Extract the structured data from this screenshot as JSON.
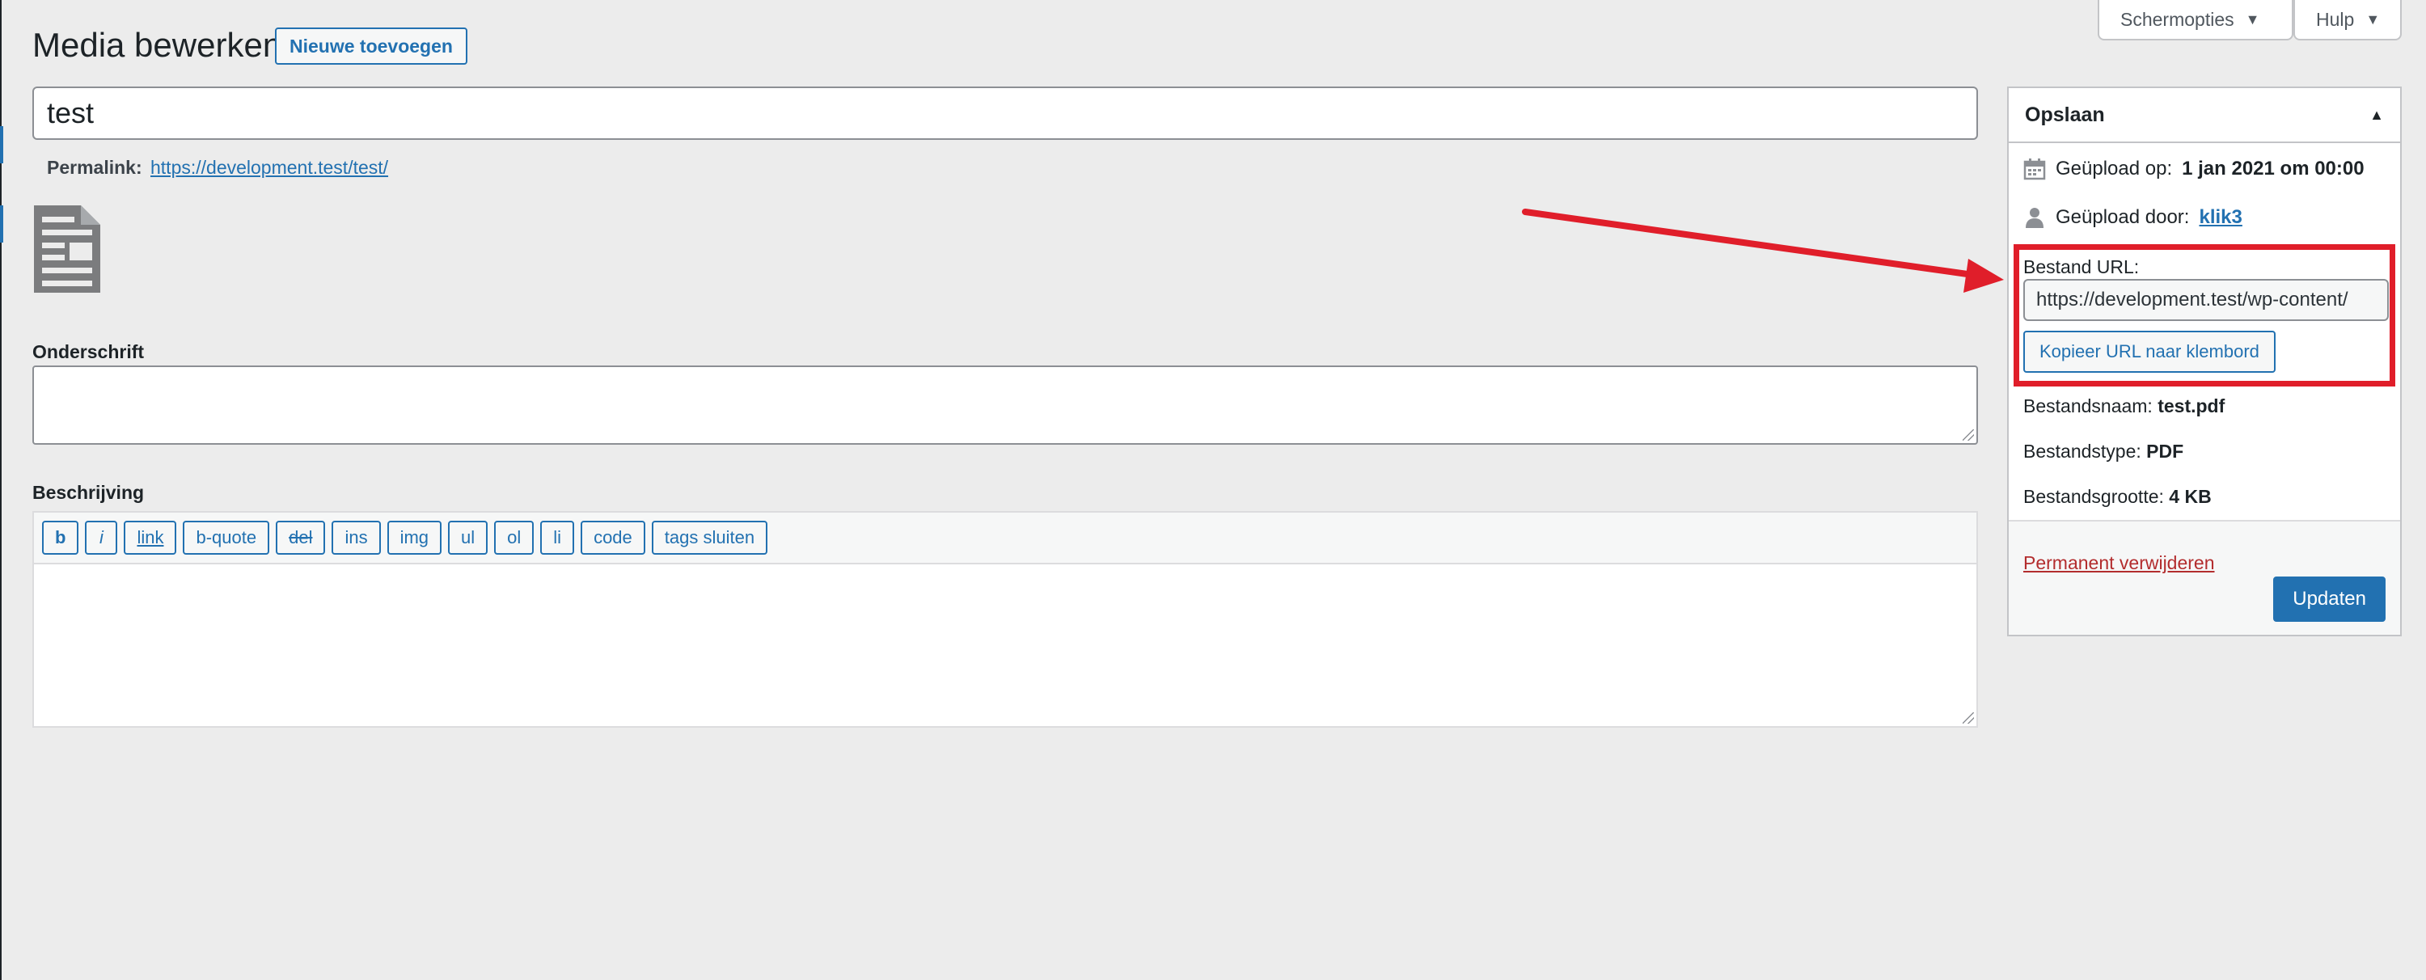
{
  "screen_tabs": {
    "screen_options": "Schermopties",
    "help": "Hulp"
  },
  "page": {
    "title": "Media bewerken",
    "add_new": "Nieuwe toevoegen"
  },
  "title_field": {
    "value": "test"
  },
  "permalink": {
    "label": "Permalink:",
    "url": "https://development.test/test/"
  },
  "caption": {
    "label": "Onderschrift",
    "value": ""
  },
  "description": {
    "label": "Beschrijving",
    "toolbar": [
      "b",
      "i",
      "link",
      "b-quote",
      "del",
      "ins",
      "img",
      "ul",
      "ol",
      "li",
      "code",
      "tags sluiten"
    ],
    "value": ""
  },
  "save_box": {
    "title": "Opslaan",
    "uploaded_on_label": "Geüpload op:",
    "uploaded_on_value": "1 jan 2021 om 00:00",
    "uploaded_by_label": "Geüpload door:",
    "uploaded_by_value": "klik3",
    "file_url_label": "Bestand URL:",
    "file_url_value": "https://development.test/wp-content/",
    "copy_button": "Kopieer URL naar klembord",
    "filename_label": "Bestandsnaam:",
    "filename_value": "test.pdf",
    "filetype_label": "Bestandstype:",
    "filetype_value": "PDF",
    "filesize_label": "Bestandsgrootte:",
    "filesize_value": "4 KB",
    "delete_link": "Permanent verwijderen",
    "update_button": "Updaten"
  },
  "colors": {
    "accent": "#2271b1",
    "annotation": "#e01e2a",
    "danger": "#b32d2e"
  },
  "icons": [
    "calendar-icon",
    "user-icon",
    "document-icon",
    "caret-down-icon",
    "caret-up-icon"
  ]
}
